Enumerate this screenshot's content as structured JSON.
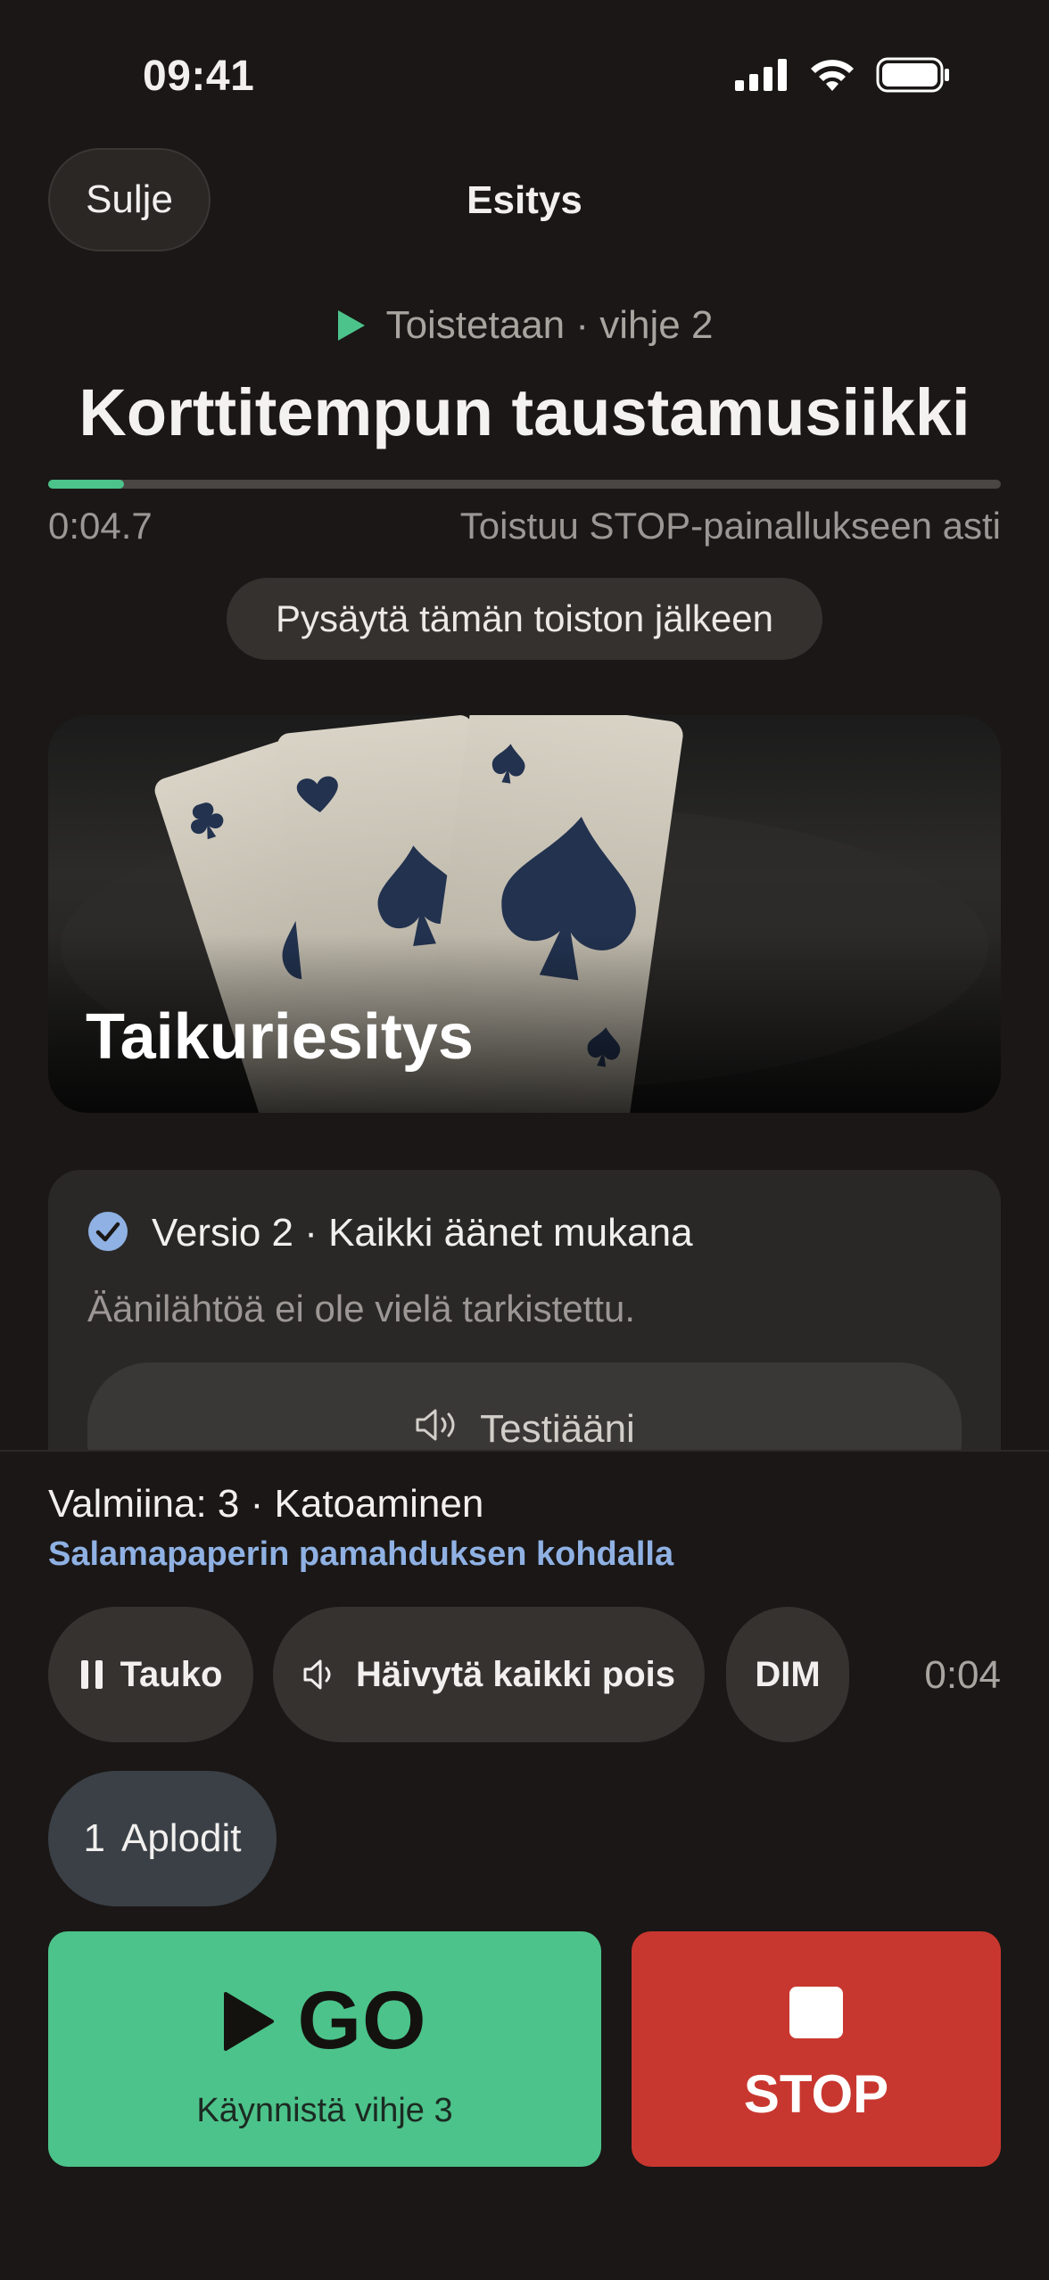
{
  "status_bar": {
    "time": "09:41"
  },
  "nav": {
    "close_label": "Sulje",
    "title": "Esitys"
  },
  "now_playing": {
    "state_text": "Toistetaan · vihje 2",
    "title": "Korttitempun taustamusiikki",
    "progress_fraction": 0.08,
    "elapsed": "0:04.7",
    "loop_note": "Toistuu STOP-painallukseen asti",
    "stop_after_label": "Pysäytä tämän toiston jälkeen"
  },
  "hero": {
    "title": "Taikuriesitys"
  },
  "version_card": {
    "version_label": "Versio 2 · Kaikki äänet mukana",
    "note": "Äänilähtöä ei ole vielä tarkistettu.",
    "test_label": "Testiääni"
  },
  "bottom": {
    "ready_label": "Valmiina: 3 · Katoaminen",
    "ready_sub": "Salamapaperin pamahduksen kohdalla",
    "pause_label": "Tauko",
    "fade_label": "Häivytä kaikki pois",
    "dim_label": "DIM",
    "timer": "0:04",
    "applause_number": "1",
    "applause_label": "Aplodit",
    "go_label": "GO",
    "go_sub": "Käynnistä vihje 3",
    "stop_label": "STOP"
  },
  "colors": {
    "background": "#1a1716",
    "accent_green": "#4cc38a",
    "stop_red": "#c8372f",
    "link_blue": "#8fb1e3"
  },
  "icons": [
    "signal-icon",
    "wifi-icon",
    "battery-icon",
    "play-icon",
    "check-circle-icon",
    "speaker-icon",
    "pause-icon",
    "stop-square-icon"
  ]
}
